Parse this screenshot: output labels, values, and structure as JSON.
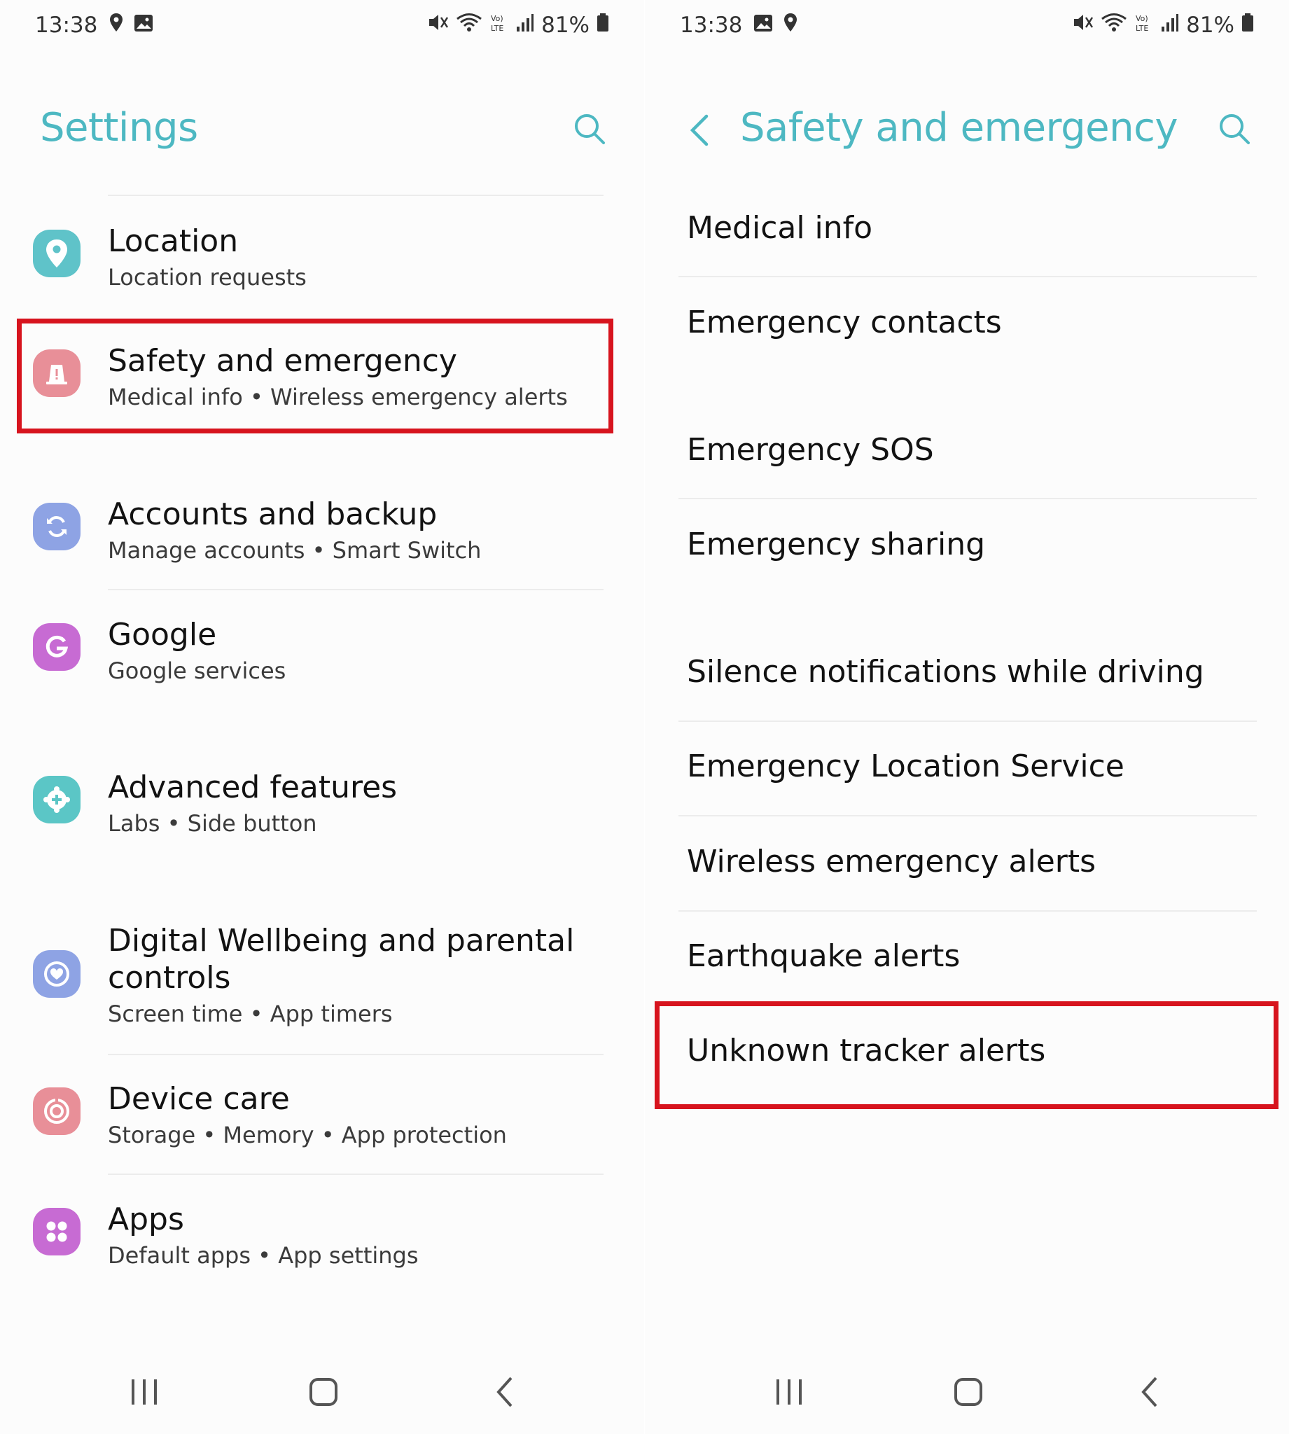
{
  "status_bar": {
    "time": "13:38",
    "battery": "81%"
  },
  "left": {
    "title": "Settings",
    "items": [
      {
        "title": "Location",
        "subtitle": "Location requests",
        "icon": "location-pin-icon"
      },
      {
        "title": "Safety and emergency",
        "subtitle": "Medical info  •  Wireless emergency alerts",
        "icon": "alert-icon"
      },
      {
        "title": "Accounts and backup",
        "subtitle": "Manage accounts  •  Smart Switch",
        "icon": "sync-icon"
      },
      {
        "title": "Google",
        "subtitle": "Google services",
        "icon": "google-icon"
      },
      {
        "title": "Advanced features",
        "subtitle": "Labs  •  Side button",
        "icon": "plus-gear-icon"
      },
      {
        "title": "Digital Wellbeing and parental controls",
        "subtitle": "Screen time  •  App timers",
        "icon": "wellbeing-icon"
      },
      {
        "title": "Device care",
        "subtitle": "Storage  •  Memory  •  App protection",
        "icon": "device-care-icon"
      },
      {
        "title": "Apps",
        "subtitle": "Default apps  •  App settings",
        "icon": "apps-icon"
      }
    ]
  },
  "right": {
    "title": "Safety and emergency",
    "items": [
      "Medical info",
      "Emergency contacts",
      "Emergency SOS",
      "Emergency sharing",
      "Silence notifications while driving",
      "Emergency Location Service",
      "Wireless emergency alerts",
      "Earthquake alerts",
      "Unknown tracker alerts"
    ]
  },
  "colors": {
    "accent": "#4db8c2",
    "highlight": "#d7141e",
    "icon_location": "#5fc3c9",
    "icon_safety": "#e88f98",
    "icon_accounts": "#8ea3e4",
    "icon_google": "#c76bd3",
    "icon_advanced": "#5bc6c6",
    "icon_wellbeing": "#8ea3e4",
    "icon_devicecare": "#e88f98",
    "icon_apps": "#c76bd3"
  }
}
